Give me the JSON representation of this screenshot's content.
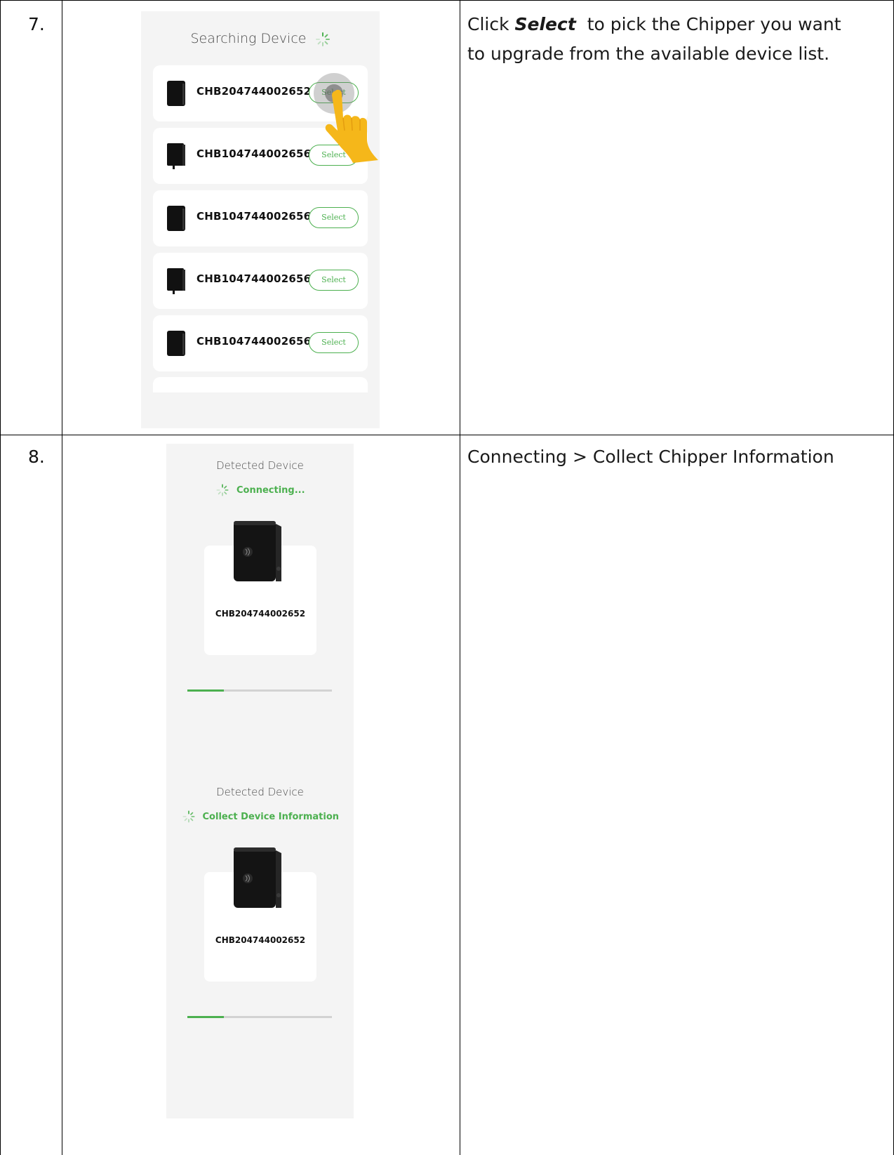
{
  "rows": [
    {
      "step": "7.",
      "instruction": {
        "prefix": "Click ",
        "emphasis": "Select",
        "line1_rest": "  to pick the Chipper you want",
        "line2": "to upgrade from the available device list."
      },
      "screen": {
        "title": "Searching Device",
        "select_label": "Select",
        "devices": [
          {
            "id": "CHB204744002652"
          },
          {
            "id": "CHB104744002656"
          },
          {
            "id": "CHB104744002656"
          },
          {
            "id": "CHB104744002656"
          },
          {
            "id": "CHB104744002656"
          }
        ]
      }
    },
    {
      "step": "8.",
      "instruction": {
        "text": "Connecting > Collect Chipper Information"
      },
      "screens": [
        {
          "title": "Detected Device",
          "status": "Connecting...",
          "device_id": "CHB204744002652",
          "progress": 0.25
        },
        {
          "title": "Detected Device",
          "status": "Collect Device Information",
          "device_id": "CHB204744002652",
          "progress": 0.25
        }
      ]
    }
  ],
  "colors": {
    "accent": "#4cb04f",
    "panel_bg": "#f4f4f4",
    "hand": "#f5b71a"
  }
}
